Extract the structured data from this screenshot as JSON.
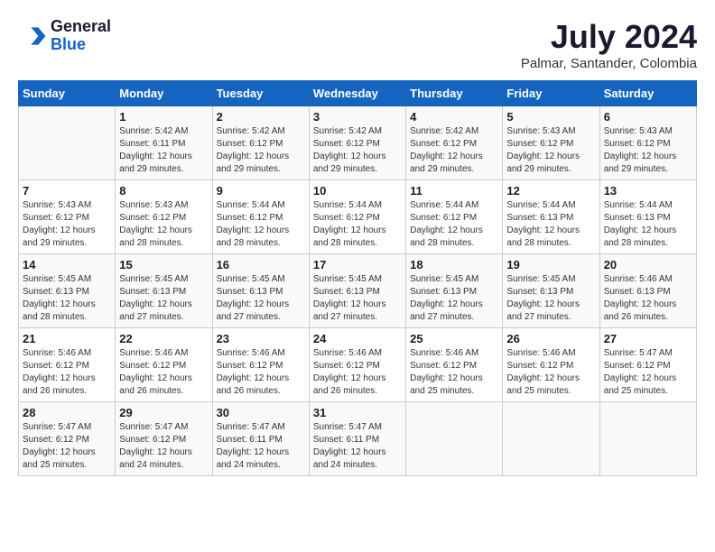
{
  "header": {
    "logo_general": "General",
    "logo_blue": "Blue",
    "month_year": "July 2024",
    "location": "Palmar, Santander, Colombia"
  },
  "days_of_week": [
    "Sunday",
    "Monday",
    "Tuesday",
    "Wednesday",
    "Thursday",
    "Friday",
    "Saturday"
  ],
  "weeks": [
    [
      {
        "day": "",
        "sunrise": "",
        "sunset": "",
        "daylight": ""
      },
      {
        "day": "1",
        "sunrise": "Sunrise: 5:42 AM",
        "sunset": "Sunset: 6:11 PM",
        "daylight": "Daylight: 12 hours and 29 minutes."
      },
      {
        "day": "2",
        "sunrise": "Sunrise: 5:42 AM",
        "sunset": "Sunset: 6:12 PM",
        "daylight": "Daylight: 12 hours and 29 minutes."
      },
      {
        "day": "3",
        "sunrise": "Sunrise: 5:42 AM",
        "sunset": "Sunset: 6:12 PM",
        "daylight": "Daylight: 12 hours and 29 minutes."
      },
      {
        "day": "4",
        "sunrise": "Sunrise: 5:42 AM",
        "sunset": "Sunset: 6:12 PM",
        "daylight": "Daylight: 12 hours and 29 minutes."
      },
      {
        "day": "5",
        "sunrise": "Sunrise: 5:43 AM",
        "sunset": "Sunset: 6:12 PM",
        "daylight": "Daylight: 12 hours and 29 minutes."
      },
      {
        "day": "6",
        "sunrise": "Sunrise: 5:43 AM",
        "sunset": "Sunset: 6:12 PM",
        "daylight": "Daylight: 12 hours and 29 minutes."
      }
    ],
    [
      {
        "day": "7",
        "sunrise": "Sunrise: 5:43 AM",
        "sunset": "Sunset: 6:12 PM",
        "daylight": "Daylight: 12 hours and 29 minutes."
      },
      {
        "day": "8",
        "sunrise": "Sunrise: 5:43 AM",
        "sunset": "Sunset: 6:12 PM",
        "daylight": "Daylight: 12 hours and 28 minutes."
      },
      {
        "day": "9",
        "sunrise": "Sunrise: 5:44 AM",
        "sunset": "Sunset: 6:12 PM",
        "daylight": "Daylight: 12 hours and 28 minutes."
      },
      {
        "day": "10",
        "sunrise": "Sunrise: 5:44 AM",
        "sunset": "Sunset: 6:12 PM",
        "daylight": "Daylight: 12 hours and 28 minutes."
      },
      {
        "day": "11",
        "sunrise": "Sunrise: 5:44 AM",
        "sunset": "Sunset: 6:12 PM",
        "daylight": "Daylight: 12 hours and 28 minutes."
      },
      {
        "day": "12",
        "sunrise": "Sunrise: 5:44 AM",
        "sunset": "Sunset: 6:13 PM",
        "daylight": "Daylight: 12 hours and 28 minutes."
      },
      {
        "day": "13",
        "sunrise": "Sunrise: 5:44 AM",
        "sunset": "Sunset: 6:13 PM",
        "daylight": "Daylight: 12 hours and 28 minutes."
      }
    ],
    [
      {
        "day": "14",
        "sunrise": "Sunrise: 5:45 AM",
        "sunset": "Sunset: 6:13 PM",
        "daylight": "Daylight: 12 hours and 28 minutes."
      },
      {
        "day": "15",
        "sunrise": "Sunrise: 5:45 AM",
        "sunset": "Sunset: 6:13 PM",
        "daylight": "Daylight: 12 hours and 27 minutes."
      },
      {
        "day": "16",
        "sunrise": "Sunrise: 5:45 AM",
        "sunset": "Sunset: 6:13 PM",
        "daylight": "Daylight: 12 hours and 27 minutes."
      },
      {
        "day": "17",
        "sunrise": "Sunrise: 5:45 AM",
        "sunset": "Sunset: 6:13 PM",
        "daylight": "Daylight: 12 hours and 27 minutes."
      },
      {
        "day": "18",
        "sunrise": "Sunrise: 5:45 AM",
        "sunset": "Sunset: 6:13 PM",
        "daylight": "Daylight: 12 hours and 27 minutes."
      },
      {
        "day": "19",
        "sunrise": "Sunrise: 5:45 AM",
        "sunset": "Sunset: 6:13 PM",
        "daylight": "Daylight: 12 hours and 27 minutes."
      },
      {
        "day": "20",
        "sunrise": "Sunrise: 5:46 AM",
        "sunset": "Sunset: 6:13 PM",
        "daylight": "Daylight: 12 hours and 26 minutes."
      }
    ],
    [
      {
        "day": "21",
        "sunrise": "Sunrise: 5:46 AM",
        "sunset": "Sunset: 6:12 PM",
        "daylight": "Daylight: 12 hours and 26 minutes."
      },
      {
        "day": "22",
        "sunrise": "Sunrise: 5:46 AM",
        "sunset": "Sunset: 6:12 PM",
        "daylight": "Daylight: 12 hours and 26 minutes."
      },
      {
        "day": "23",
        "sunrise": "Sunrise: 5:46 AM",
        "sunset": "Sunset: 6:12 PM",
        "daylight": "Daylight: 12 hours and 26 minutes."
      },
      {
        "day": "24",
        "sunrise": "Sunrise: 5:46 AM",
        "sunset": "Sunset: 6:12 PM",
        "daylight": "Daylight: 12 hours and 26 minutes."
      },
      {
        "day": "25",
        "sunrise": "Sunrise: 5:46 AM",
        "sunset": "Sunset: 6:12 PM",
        "daylight": "Daylight: 12 hours and 25 minutes."
      },
      {
        "day": "26",
        "sunrise": "Sunrise: 5:46 AM",
        "sunset": "Sunset: 6:12 PM",
        "daylight": "Daylight: 12 hours and 25 minutes."
      },
      {
        "day": "27",
        "sunrise": "Sunrise: 5:47 AM",
        "sunset": "Sunset: 6:12 PM",
        "daylight": "Daylight: 12 hours and 25 minutes."
      }
    ],
    [
      {
        "day": "28",
        "sunrise": "Sunrise: 5:47 AM",
        "sunset": "Sunset: 6:12 PM",
        "daylight": "Daylight: 12 hours and 25 minutes."
      },
      {
        "day": "29",
        "sunrise": "Sunrise: 5:47 AM",
        "sunset": "Sunset: 6:12 PM",
        "daylight": "Daylight: 12 hours and 24 minutes."
      },
      {
        "day": "30",
        "sunrise": "Sunrise: 5:47 AM",
        "sunset": "Sunset: 6:11 PM",
        "daylight": "Daylight: 12 hours and 24 minutes."
      },
      {
        "day": "31",
        "sunrise": "Sunrise: 5:47 AM",
        "sunset": "Sunset: 6:11 PM",
        "daylight": "Daylight: 12 hours and 24 minutes."
      },
      {
        "day": "",
        "sunrise": "",
        "sunset": "",
        "daylight": ""
      },
      {
        "day": "",
        "sunrise": "",
        "sunset": "",
        "daylight": ""
      },
      {
        "day": "",
        "sunrise": "",
        "sunset": "",
        "daylight": ""
      }
    ]
  ]
}
